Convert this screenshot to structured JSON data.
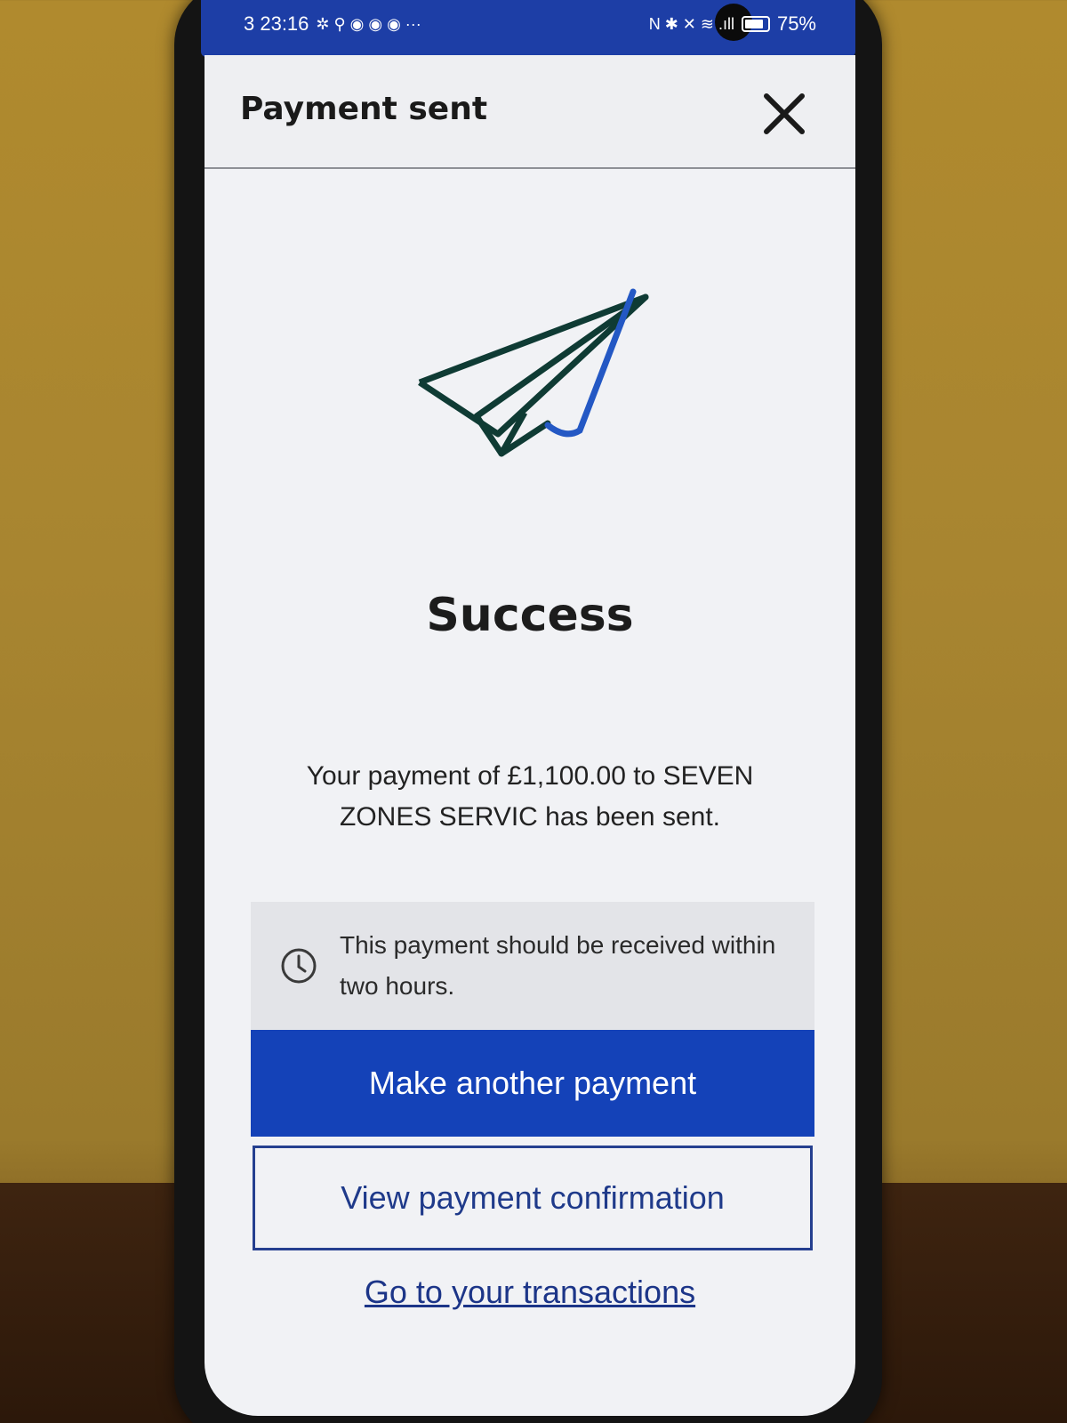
{
  "status_bar": {
    "time": "3 23:16",
    "extra_icons": "✲ ⚲ ◉ ◉ ◉ ···",
    "battery": "75%",
    "right_icons": "N ✱ ✕ ≋ .ıll"
  },
  "header": {
    "title": "Payment sent",
    "close_icon": "close-icon"
  },
  "hero": {
    "icon": "paper-plane-check-icon",
    "heading": "Success"
  },
  "message": "Your payment of £1,100.00 to SEVEN ZONES SERVIC has been sent.",
  "info": {
    "icon": "clock-icon",
    "text": "This payment should be received within two hours."
  },
  "actions": {
    "primary_label": "Make another payment",
    "secondary_label": "View payment confirmation",
    "link_label": "Go to your transactions"
  },
  "colors": {
    "primary_button": "#1442b8",
    "status_bar": "#1d3ea6",
    "plane_stroke": "#0f3b34",
    "check_stroke": "#2458c4"
  }
}
